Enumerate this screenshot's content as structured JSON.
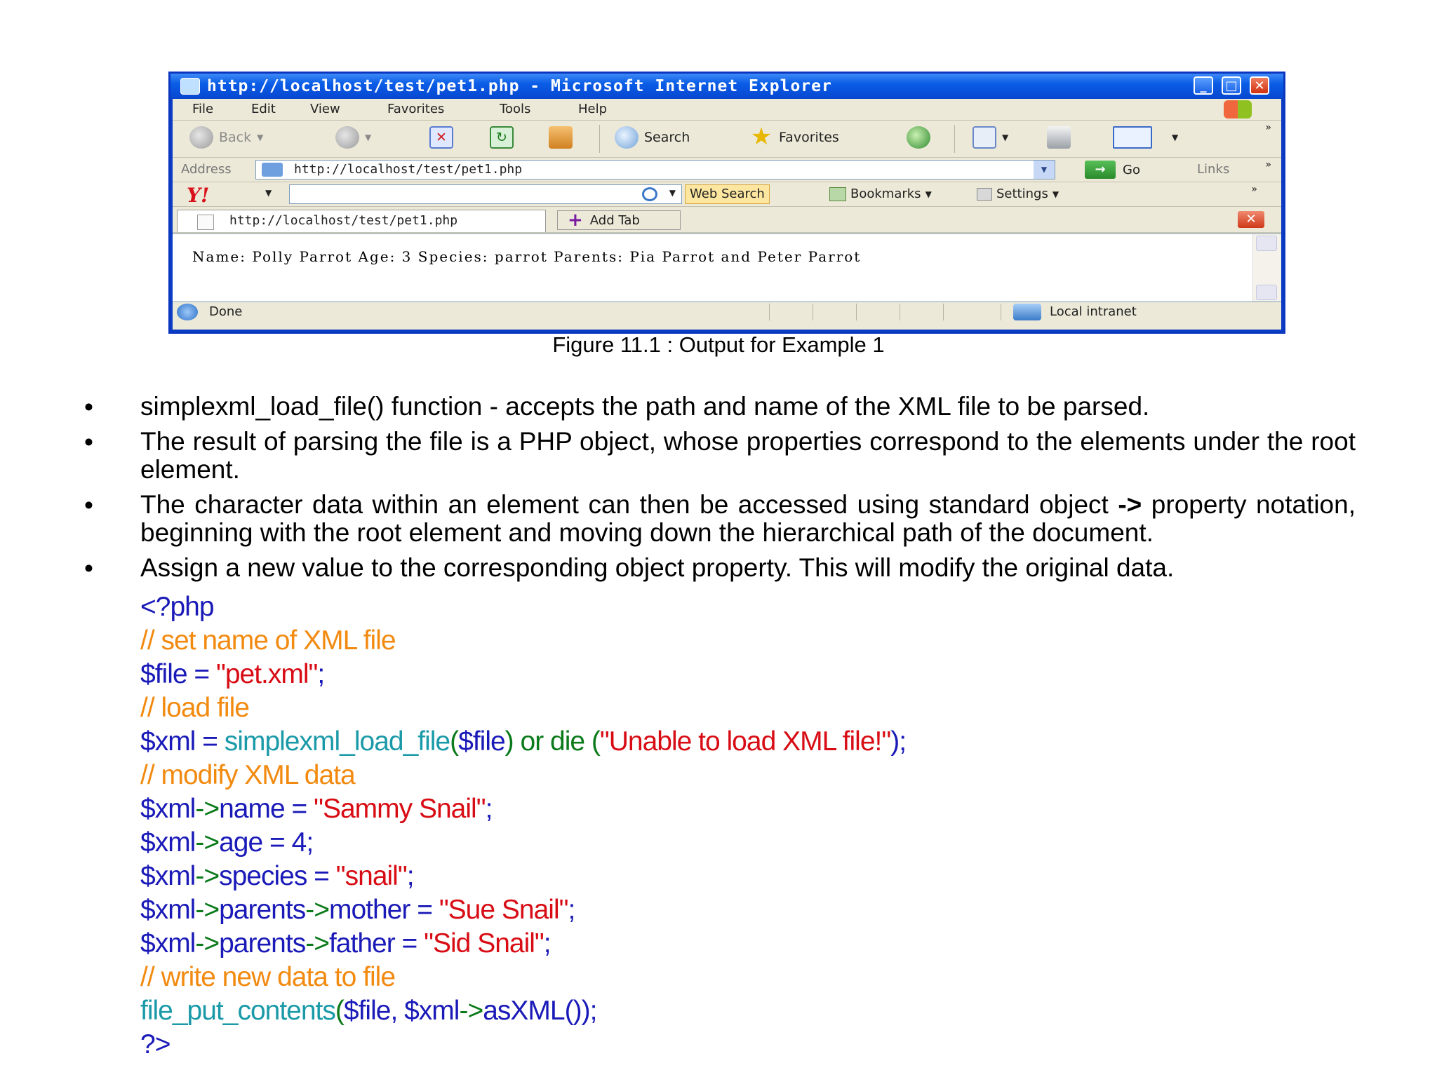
{
  "browser": {
    "title": "http://localhost/test/pet1.php - Microsoft Internet Explorer",
    "window_buttons": [
      "_",
      "□",
      "✕"
    ],
    "menu": [
      "File",
      "Edit",
      "View",
      "Favorites",
      "Tools",
      "Help"
    ],
    "toolbar": {
      "back": "Back",
      "search": "Search",
      "favorites": "Favorites"
    },
    "address_label": "Address",
    "address_value": "http://localhost/test/pet1.php",
    "go_label": "Go",
    "links_label": "Links",
    "yahoo": {
      "logo": "Y!",
      "web_search": "Web Search",
      "bookmarks": "Bookmarks",
      "settings": "Settings"
    },
    "tab_label": "http://localhost/test/pet1.php",
    "add_tab": "Add Tab",
    "page_text": "Name: Polly Parrot Age: 3 Species: parrot Parents: Pia Parrot and Peter Parrot",
    "status_done": "Done",
    "status_zone": "Local intranet"
  },
  "caption": "Figure 11.1 : Output for Example 1",
  "bullets": [
    "simplexml_load_file() function - accepts the path and name of the XML file to be parsed.",
    "The result of parsing the file is a PHP object, whose properties correspond to the elements under the root element.",
    {
      "before": "The character data within an element can then be accessed using standard object ",
      "bold": "->",
      "after": " property notation, beginning with the root element and moving down the hierarchical path of the document."
    },
    "Assign a new value to the corresponding object property. This will modify the original data."
  ],
  "bullet_char": "•",
  "code": {
    "open_tag": "<?php",
    "comment1": "// set name of XML file",
    "line_file": {
      "var": "$file",
      "op": " = ",
      "str": "\"pet.xml\"",
      "end": ";"
    },
    "comment2": "// load file",
    "line_load": {
      "var": "$xml",
      "op": " = ",
      "fn": "simplexml_load_file",
      "paren_open": "(",
      "arg": "$file",
      "paren_close": ")",
      "ordie": " or die (",
      "str": "\"Unable to load XML file!\"",
      "end": ");"
    },
    "comment3": "// modify XML data",
    "line_name": {
      "var": "$xml",
      "arrow": "->",
      "prop": "name",
      "op": " = ",
      "str": "\"Sammy Snail\"",
      "end": ";"
    },
    "line_age": {
      "var": "$xml",
      "arrow": "->",
      "prop": "age",
      "op": " = ",
      "num": "4",
      "end": ";"
    },
    "line_species": {
      "var": "$xml",
      "arrow": "->",
      "prop": "species",
      "op": " = ",
      "str": "\"snail\"",
      "end": ";"
    },
    "line_mother": {
      "var": "$xml",
      "arrow": "->",
      "prop": "parents",
      "arrow2": "->",
      "prop2": "mother",
      "op": " = ",
      "str": "\"Sue Snail\"",
      "end": ";"
    },
    "line_father": {
      "var": "$xml",
      "arrow": "->",
      "prop": "parents",
      "arrow2": "->",
      "prop2": "father",
      "op": " = ",
      "str": "\"Sid Snail\"",
      "end": ";"
    },
    "comment4": "// write new data to file",
    "line_put": {
      "fn": "file_put_contents",
      "paren_open": "(",
      "arg1": "$file",
      "comma": ", ",
      "arg2": "$xml",
      "arrow": "->",
      "method": "asXML",
      "end": "());"
    },
    "close_tag": "?>"
  },
  "colors": {
    "keyword_blue": "#1a1ab8",
    "comment_orange": "#f28a10",
    "string_red": "#d80c14",
    "function_teal": "#1a9aa8",
    "ordie_green": "#0a7a1a"
  }
}
